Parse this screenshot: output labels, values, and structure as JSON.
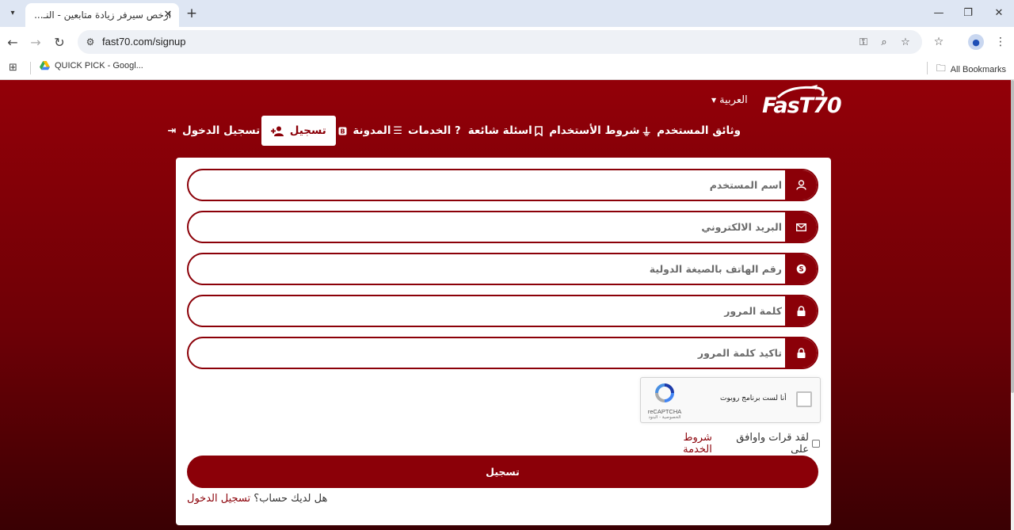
{
  "browser": {
    "tab_title": "ارخص سيرفر زيادة متابعين - النـ...",
    "url": "fast70.com/signup",
    "bookmark_item": "QUICK PICK - Googl...",
    "all_bookmarks": "All Bookmarks"
  },
  "site": {
    "logo_text": "FasT70",
    "language": "العربية",
    "nav": [
      {
        "label": "وثائق المستخدم",
        "icon": "plug-icon"
      },
      {
        "label": "شروط الأستخدام",
        "icon": "bookmark-icon"
      },
      {
        "label": "اسئلة شائعة",
        "icon": "question-icon"
      },
      {
        "label": "الخدمات",
        "icon": "list-icon"
      },
      {
        "label": "المدونة",
        "icon": "blogger-icon"
      },
      {
        "label": "تسجيل",
        "icon": "user-plus-icon",
        "active": true
      },
      {
        "label": "تسجيل الدخول",
        "icon": "sign-in-icon"
      }
    ]
  },
  "form": {
    "username_placeholder": "اسم المستخدم",
    "email_placeholder": "البريد الالكتروني",
    "phone_placeholder": "رقم الهاتف بالصيغة الدولية",
    "password_placeholder": "كلمة المرور",
    "confirm_placeholder": "تاكيد كلمة المرور",
    "captcha_label": "أنا لست برنامج روبوت",
    "captcha_brand": "reCAPTCHA",
    "captcha_terms": "الخصوصية - البنود",
    "terms_text": "لقد قرات واوافق على",
    "terms_link": "شروط الخدمة",
    "submit_label": "تسجيل",
    "have_account": "هل لديك حساب؟",
    "login_link": "تسجيل الدخول"
  },
  "colors": {
    "brand": "#8b0008",
    "background_top": "#930008",
    "background_bottom": "#3a0003"
  }
}
